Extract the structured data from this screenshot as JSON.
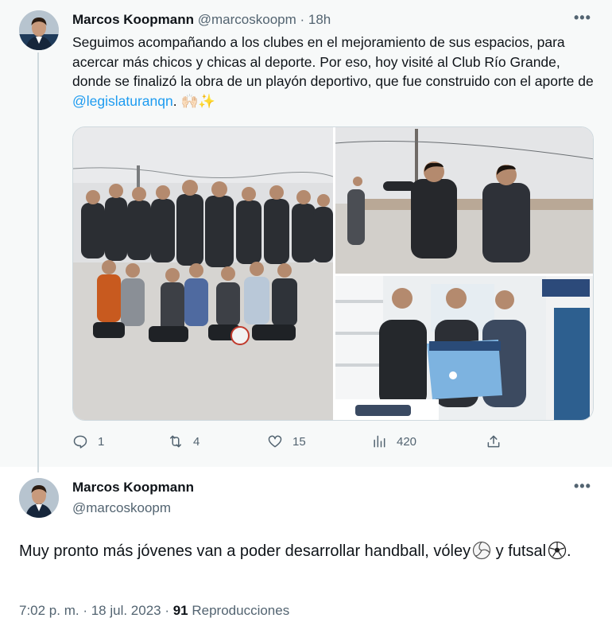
{
  "tweet1": {
    "author_name": "Marcos Koopmann",
    "author_handle": "@marcoskoopm",
    "separator": " · ",
    "time_ago": "18h",
    "more_icon": "more-dots-icon",
    "text_part1": "Seguimos acompañando a los clubes en el mejoramiento de sus espacios, para acercar más chicos y chicas al deporte. Por eso, hoy visité al  Club Río Grande, donde se finalizó la obra de un playón deportivo, que fue construido con el aporte de ",
    "mention": "@legislaturanqn",
    "text_part2": ". 🙌🏻✨",
    "media": [
      {
        "name": "group-photo"
      },
      {
        "name": "field-visit-photo"
      },
      {
        "name": "jersey-photo"
      }
    ],
    "actions": {
      "reply_count": "1",
      "retweet_count": "4",
      "like_count": "15",
      "views_count": "420"
    },
    "icons": {
      "reply": "reply-icon",
      "retweet": "retweet-icon",
      "like": "heart-icon",
      "views": "views-icon",
      "share": "share-icon"
    }
  },
  "tweet2": {
    "author_name": "Marcos Koopmann",
    "author_handle": "@marcoskoopm",
    "text_part1": "Muy pronto más jóvenes van a poder desarrollar handball, vóley",
    "text_part2": " y futsal",
    "text_part3": ".",
    "timestamp": "7:02 p. m. · 18 jul. 2023 · ",
    "views_count": "91",
    "views_label": " Reproducciones"
  },
  "colors": {
    "accent": "#1d9bf0",
    "secondary_text": "#536471",
    "thread_line": "#cfd9de",
    "tweet_bg": "#f7f9f9"
  }
}
